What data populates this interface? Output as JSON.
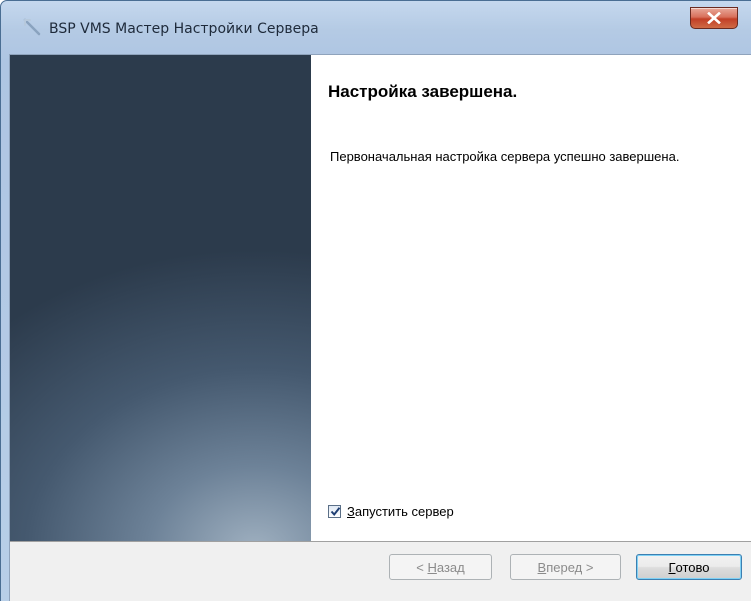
{
  "window": {
    "title": "BSP VMS Мастер Настройки Сервера",
    "close_icon": "close-icon"
  },
  "content": {
    "heading": "Настройка завершена.",
    "message": "Первоначальная настройка сервера успешно завершена."
  },
  "start_server": {
    "label_accel": "З",
    "label_rest": "апустить сервер",
    "checked": true
  },
  "buttons": {
    "back": {
      "prefix": "< ",
      "accel": "Н",
      "rest": "азад",
      "enabled": false
    },
    "next": {
      "prefix": "",
      "accel": "В",
      "rest": "перед >",
      "enabled": false
    },
    "finish": {
      "accel": "Г",
      "rest": "отово",
      "enabled": true
    }
  },
  "colors": {
    "side_panel_dark": "#2c3b4c",
    "side_panel_light": "#9fb0c0",
    "close_button_red": "#c23f27",
    "default_button_border": "#3c7fb1"
  }
}
